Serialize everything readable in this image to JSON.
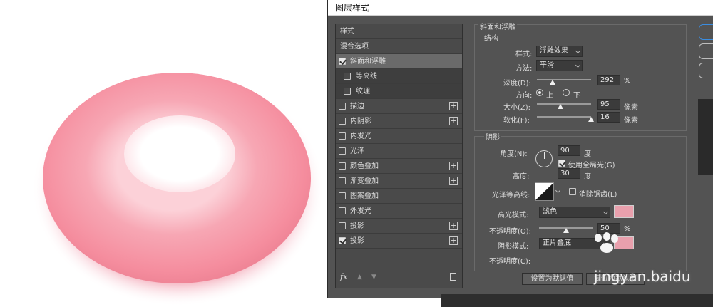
{
  "dialog": {
    "title": "图层样式"
  },
  "style_list": {
    "items": [
      {
        "label": "样式",
        "type": "plain"
      },
      {
        "label": "混合选项",
        "type": "plain"
      },
      {
        "label": "斜面和浮雕",
        "type": "check",
        "checked": true,
        "selected": true
      },
      {
        "label": "等高线",
        "type": "sub",
        "checked": false
      },
      {
        "label": "纹理",
        "type": "sub",
        "checked": false
      },
      {
        "label": "描边",
        "type": "check",
        "checked": false,
        "plus": true
      },
      {
        "label": "内阴影",
        "type": "check",
        "checked": false,
        "plus": true
      },
      {
        "label": "内发光",
        "type": "check",
        "checked": false
      },
      {
        "label": "光泽",
        "type": "check",
        "checked": false
      },
      {
        "label": "颜色叠加",
        "type": "check",
        "checked": false,
        "plus": true
      },
      {
        "label": "渐变叠加",
        "type": "check",
        "checked": false,
        "plus": true
      },
      {
        "label": "图案叠加",
        "type": "check",
        "checked": false
      },
      {
        "label": "外发光",
        "type": "check",
        "checked": false
      },
      {
        "label": "投影",
        "type": "check",
        "checked": false,
        "plus": true
      },
      {
        "label": "投影",
        "type": "check",
        "checked": true,
        "plus": true
      }
    ],
    "footer": {
      "fx": "fx",
      "plus_sign": "+"
    }
  },
  "bevel": {
    "section_title": "斜面和浮雕",
    "structure_title": "结构",
    "style_label": "样式:",
    "style_value": "浮雕效果",
    "technique_label": "方法:",
    "technique_value": "平滑",
    "depth_label": "深度(D):",
    "depth_value": "292",
    "depth_unit": "%",
    "direction_label": "方向:",
    "dir_up": "上",
    "dir_down": "下",
    "size_label": "大小(Z):",
    "size_value": "95",
    "size_unit": "像素",
    "soften_label": "软化(F):",
    "soften_value": "16",
    "soften_unit": "像素",
    "shading_title": "阴影",
    "angle_label": "角度(N):",
    "angle_value": "90",
    "angle_unit": "度",
    "global_light_label": "使用全局光(G)",
    "altitude_label": "高度:",
    "altitude_value": "30",
    "altitude_unit": "度",
    "gloss_label": "光泽等高线:",
    "antialias_label": "消除锯齿(L)",
    "highlight_mode_label": "高光模式:",
    "highlight_mode_value": "滤色",
    "highlight_opacity_label": "不透明度(O):",
    "highlight_opacity_value": "50",
    "highlight_opacity_unit": "%",
    "shadow_mode_label": "阴影模式:",
    "shadow_mode_value": "正片叠底",
    "shadow_opacity_label": "不透明度(C):",
    "highlight_color": "#e9a0ad",
    "shadow_color": "#e9a0ad"
  },
  "buttons": {
    "set_default": "设置为默认值",
    "reset_default": "复位为默认值"
  },
  "watermark": "jingyan.baidu"
}
